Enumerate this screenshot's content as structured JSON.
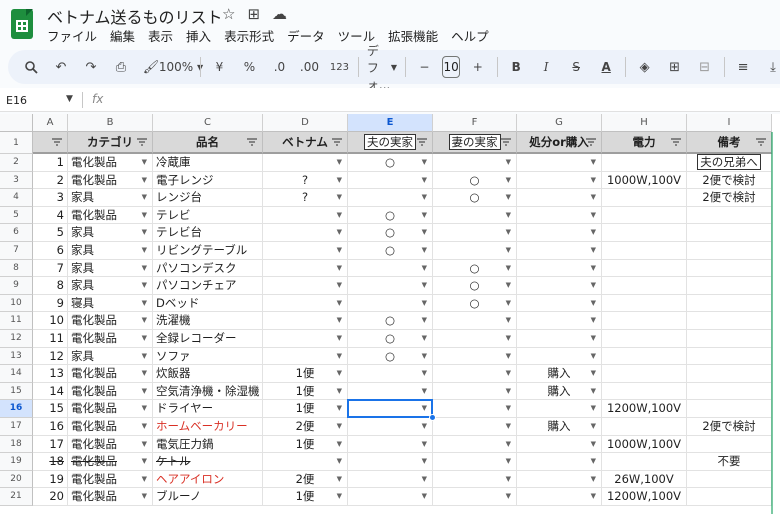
{
  "title": "ベトナム送るものリスト",
  "title_icons": [
    "star-icon",
    "move-folder-icon",
    "cloud-status-icon"
  ],
  "menu": [
    "ファイル",
    "編集",
    "表示",
    "挿入",
    "表示形式",
    "データ",
    "ツール",
    "拡張機能",
    "ヘルプ"
  ],
  "toolbar": {
    "zoom": "100%",
    "currency": "¥",
    "percent": "%",
    "dec_decrease": ".0",
    "dec_increase": ".00",
    "format_num": "123",
    "font": "デフォ...",
    "font_size": "10",
    "minus": "−",
    "plus": "+",
    "bold": "B",
    "italic": "I",
    "strike": "S",
    "textcolor": "A"
  },
  "formula_bar": {
    "cell_ref": "E16",
    "fx": "fx"
  },
  "grid": {
    "columns": [
      "A",
      "B",
      "C",
      "D",
      "E",
      "F",
      "G",
      "H",
      "I"
    ],
    "selected_column": "E",
    "selected_row": "16",
    "headers": [
      "",
      "カテゴリ",
      "品名",
      "ベトナム",
      "夫の実家",
      "妻の実家",
      "処分or購入",
      "電力",
      "備考"
    ],
    "rows": [
      {
        "n": "2",
        "a": "1",
        "b": "電化製品",
        "c": "冷蔵庫",
        "d": "",
        "e": "○",
        "f": "",
        "g": "",
        "h": "",
        "i": "夫の兄弟へ",
        "i_boxed": true
      },
      {
        "n": "3",
        "a": "2",
        "b": "電化製品",
        "c": "電子レンジ",
        "d": "?",
        "e": "",
        "f": "○",
        "g": "",
        "h": "1000W,100V",
        "i": "2便で検討"
      },
      {
        "n": "4",
        "a": "3",
        "b": "家具",
        "c": "レンジ台",
        "d": "?",
        "e": "",
        "f": "○",
        "g": "",
        "h": "",
        "i": "2便で検討"
      },
      {
        "n": "5",
        "a": "4",
        "b": "電化製品",
        "c": "テレビ",
        "d": "",
        "e": "○",
        "f": "",
        "g": "",
        "h": "",
        "i": ""
      },
      {
        "n": "6",
        "a": "5",
        "b": "家具",
        "c": "テレビ台",
        "d": "",
        "e": "○",
        "f": "",
        "g": "",
        "h": "",
        "i": ""
      },
      {
        "n": "7",
        "a": "6",
        "b": "家具",
        "c": "リビングテーブル",
        "d": "",
        "e": "○",
        "f": "",
        "g": "",
        "h": "",
        "i": ""
      },
      {
        "n": "8",
        "a": "7",
        "b": "家具",
        "c": "パソコンデスク",
        "d": "",
        "e": "",
        "f": "○",
        "g": "",
        "h": "",
        "i": ""
      },
      {
        "n": "9",
        "a": "8",
        "b": "家具",
        "c": "パソコンチェア",
        "d": "",
        "e": "",
        "f": "○",
        "g": "",
        "h": "",
        "i": ""
      },
      {
        "n": "10",
        "a": "9",
        "b": "寝具",
        "c": "Dベッド",
        "d": "",
        "e": "",
        "f": "○",
        "g": "",
        "h": "",
        "i": ""
      },
      {
        "n": "11",
        "a": "10",
        "b": "電化製品",
        "c": "洗濯機",
        "d": "",
        "e": "○",
        "f": "",
        "g": "",
        "h": "",
        "i": ""
      },
      {
        "n": "12",
        "a": "11",
        "b": "電化製品",
        "c": "全録レコーダー",
        "d": "",
        "e": "○",
        "f": "",
        "g": "",
        "h": "",
        "i": ""
      },
      {
        "n": "13",
        "a": "12",
        "b": "家具",
        "c": "ソファ",
        "d": "",
        "e": "○",
        "f": "",
        "g": "",
        "h": "",
        "i": ""
      },
      {
        "n": "14",
        "a": "13",
        "b": "電化製品",
        "c": "炊飯器",
        "d": "1便",
        "e": "",
        "f": "",
        "g": "購入",
        "h": "",
        "i": ""
      },
      {
        "n": "15",
        "a": "14",
        "b": "電化製品",
        "c": "空気清浄機・除湿機",
        "d": "1便",
        "e": "",
        "f": "",
        "g": "購入",
        "h": "",
        "i": ""
      },
      {
        "n": "16",
        "a": "15",
        "b": "電化製品",
        "c": "ドライヤー",
        "d": "1便",
        "e": "",
        "f": "",
        "g": "",
        "h": "1200W,100V",
        "i": ""
      },
      {
        "n": "17",
        "a": "16",
        "b": "電化製品",
        "c": "ホームベーカリー",
        "c_red": true,
        "d": "2便",
        "e": "",
        "f": "",
        "g": "購入",
        "h": "",
        "i": "2便で検討"
      },
      {
        "n": "18",
        "a": "17",
        "b": "電化製品",
        "c": "電気圧力鍋",
        "d": "1便",
        "e": "",
        "f": "",
        "g": "",
        "h": "1000W,100V",
        "i": ""
      },
      {
        "n": "19",
        "a": "18",
        "b": "電化製品",
        "c": "ケトル",
        "strike": true,
        "d": "",
        "e": "",
        "f": "",
        "g": "",
        "h": "",
        "i": "不要"
      },
      {
        "n": "20",
        "a": "19",
        "b": "電化製品",
        "c": "ヘアアイロン",
        "c_red": true,
        "d": "2便",
        "e": "",
        "f": "",
        "g": "",
        "h": "26W,100V",
        "i": ""
      },
      {
        "n": "21",
        "a": "20",
        "b": "電化製品",
        "c": "ブルーノ",
        "d": "1便",
        "e": "",
        "f": "",
        "g": "",
        "h": "1200W,100V",
        "i": ""
      }
    ]
  },
  "colors": {
    "accent": "#1a73e8",
    "red_text": "#d93025",
    "header_fill": "#d9d9d9",
    "logo": "#1e8e3e"
  }
}
